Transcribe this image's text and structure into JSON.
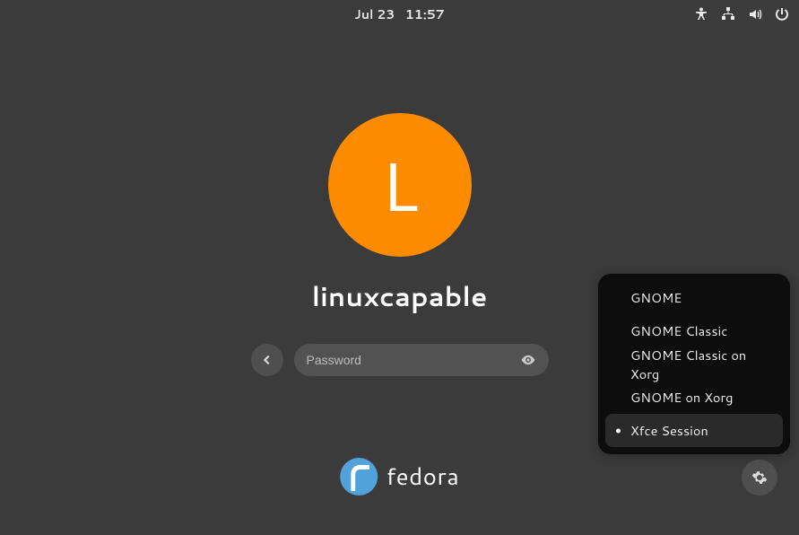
{
  "topbar": {
    "date": "Jul 23",
    "time": "11:57"
  },
  "tray": {
    "icons": [
      "accessibility",
      "network-wired",
      "volume",
      "power"
    ]
  },
  "login": {
    "avatar_initial": "L",
    "avatar_color": "#ff8c00",
    "username": "linuxcapable",
    "password_placeholder": "Password",
    "password_value": ""
  },
  "sessions": {
    "items": [
      {
        "label": "GNOME",
        "selected": false
      },
      {
        "label": "GNOME Classic",
        "selected": false
      },
      {
        "label": "GNOME Classic on Xorg",
        "selected": false
      },
      {
        "label": "GNOME on Xorg",
        "selected": false
      },
      {
        "label": "Xfce Session",
        "selected": true
      }
    ]
  },
  "branding": {
    "distro": "fedora"
  }
}
